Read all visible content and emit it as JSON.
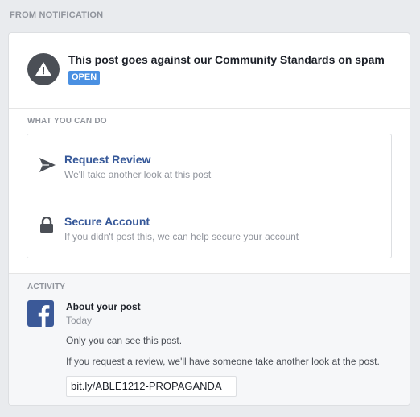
{
  "section_label": "FROM NOTIFICATION",
  "header": {
    "icon": "warning-triangle-icon",
    "title": "This post goes against our Community Standards on spam",
    "badge": "OPEN"
  },
  "what_you_can_do": {
    "label": "WHAT YOU CAN DO",
    "options": [
      {
        "icon": "send-arrow-icon",
        "title": "Request Review",
        "subtitle": "We'll take another look at this post"
      },
      {
        "icon": "lock-icon",
        "title": "Secure Account",
        "subtitle": "If you didn't post this, we can help secure your account"
      }
    ]
  },
  "activity": {
    "label": "ACTIVITY",
    "icon": "facebook-icon",
    "title": "About your post",
    "time": "Today",
    "lines": [
      "Only you can see this post.",
      "If you request a review, we'll have someone take another look at the post."
    ],
    "link": "bit.ly/ABLE1212-PROPAGANDA"
  },
  "colors": {
    "background": "#e9ebee",
    "link_blue": "#365899",
    "badge_blue": "#4a90e2",
    "facebook_blue": "#3b5998",
    "muted_text": "#90949c"
  }
}
